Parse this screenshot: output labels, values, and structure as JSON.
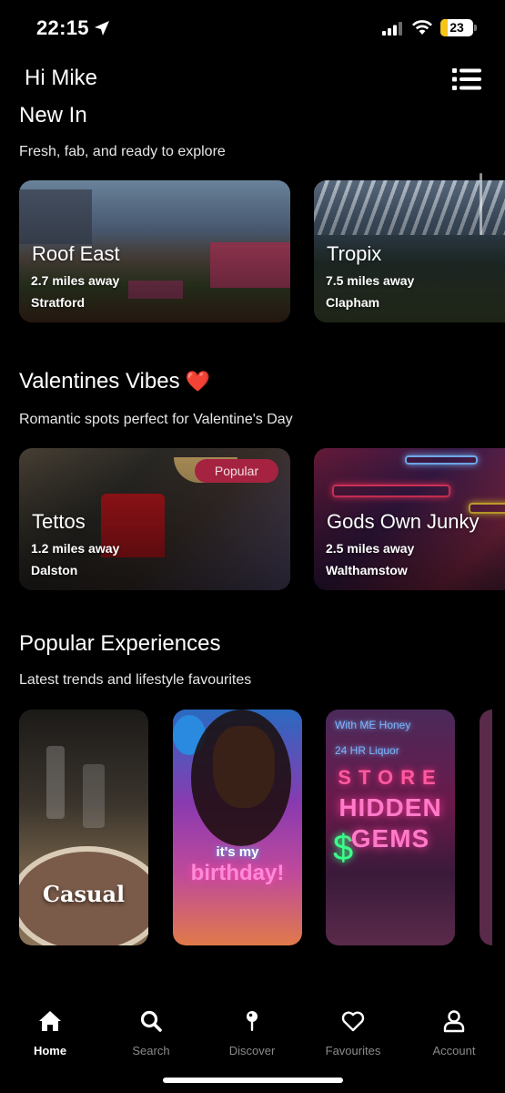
{
  "status": {
    "time": "22:15",
    "battery_level": "23",
    "icons": [
      "location-arrow-icon",
      "signal-icon",
      "wifi-icon",
      "battery-icon"
    ]
  },
  "header": {
    "greeting": "Hi Mike",
    "menu_icon": "list-menu-icon"
  },
  "sections": {
    "new_in": {
      "title": "New In",
      "subtitle": "Fresh, fab, and ready to explore",
      "cards": [
        {
          "name": "Roof East",
          "distance": "2.7 miles away",
          "area": "Stratford"
        },
        {
          "name": "Tropix",
          "distance": "7.5 miles away",
          "area": "Clapham"
        }
      ]
    },
    "valentines": {
      "title": "Valentines Vibes",
      "emoji": "❤️",
      "subtitle": "Romantic spots perfect for Valentine's Day",
      "cards": [
        {
          "name": "Tettos",
          "distance": "1.2 miles away",
          "area": "Dalston",
          "badge": "Popular"
        },
        {
          "name": "Gods Own Junky",
          "distance": "2.5 miles away",
          "area": "Walthamstow"
        }
      ]
    },
    "popular": {
      "title": "Popular Experiences",
      "subtitle": "Latest trends and lifestyle favourites",
      "cards": [
        {
          "label": "Casual"
        },
        {
          "label_line1": "it's my",
          "label_line2": "birthday!"
        },
        {
          "label_line1": "HIDDEN",
          "label_line2": "GEMS",
          "sign_top": "With ME Honey",
          "sign_mid": "24 HR Liquor",
          "sign_store": "STORE"
        }
      ]
    }
  },
  "tab_bar": {
    "tabs": [
      {
        "label": "Home",
        "icon": "home-icon",
        "active": true
      },
      {
        "label": "Search",
        "icon": "search-icon",
        "active": false
      },
      {
        "label": "Discover",
        "icon": "map-pin-icon",
        "active": false
      },
      {
        "label": "Favourites",
        "icon": "heart-icon",
        "active": false
      },
      {
        "label": "Account",
        "icon": "user-icon",
        "active": false
      }
    ]
  },
  "colors": {
    "background": "#000000",
    "badge": "#a52340",
    "heart": "#e0202e",
    "inactive_tab": "#8a8a8a"
  }
}
